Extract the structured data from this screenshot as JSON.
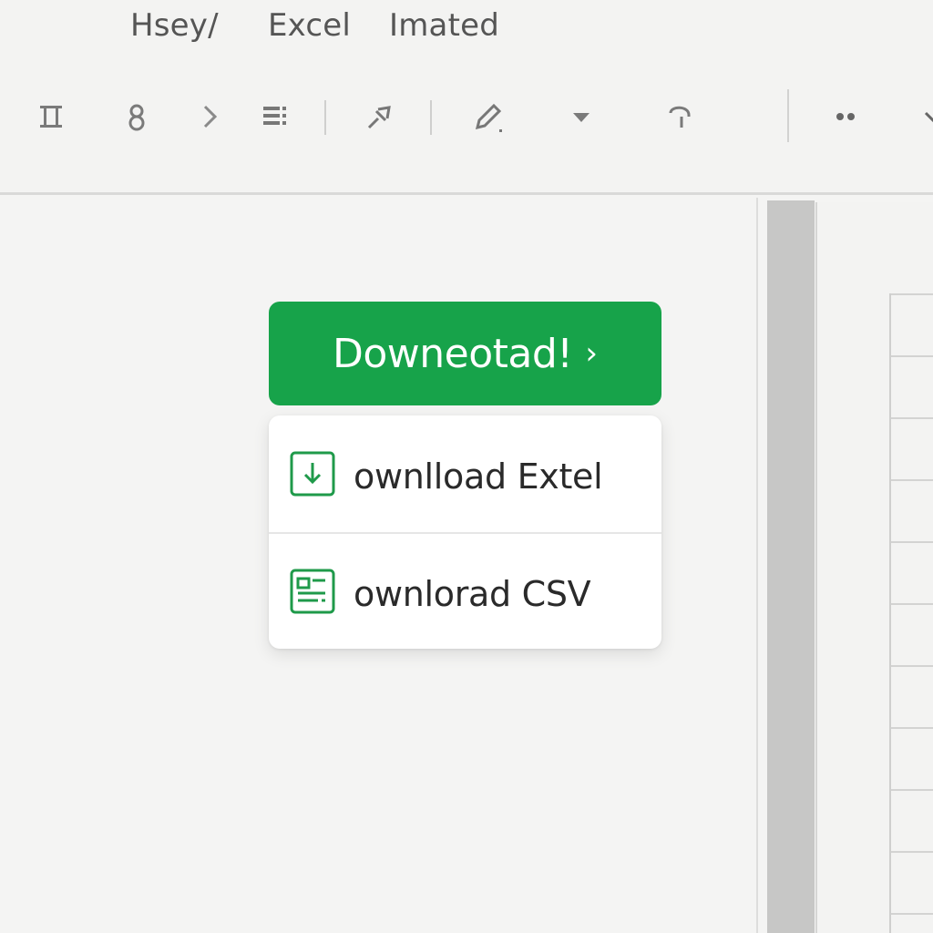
{
  "header": {
    "tabs": [
      {
        "label": "Hsey/"
      },
      {
        "label": "Excel"
      },
      {
        "label": "Imated"
      }
    ],
    "toolbar": {
      "icons": [
        "columns-icon",
        "user-icon",
        "chevron-right-icon",
        "list-grid-icon",
        "pin-icon",
        "pencil-icon",
        "dropdown-caret-icon",
        "redo-hook-icon",
        "more-icon",
        "expand-caret-icon"
      ]
    }
  },
  "download": {
    "button_label": "Downeotad!",
    "chevron": "›"
  },
  "menu": {
    "items": [
      {
        "label": "ownlload Extel",
        "icon": "download-icon"
      },
      {
        "label": "ownlorad CSV",
        "icon": "csv-file-icon"
      }
    ]
  },
  "colors": {
    "accent_green": "#17a34a",
    "icon_green": "#1f9a4a"
  }
}
